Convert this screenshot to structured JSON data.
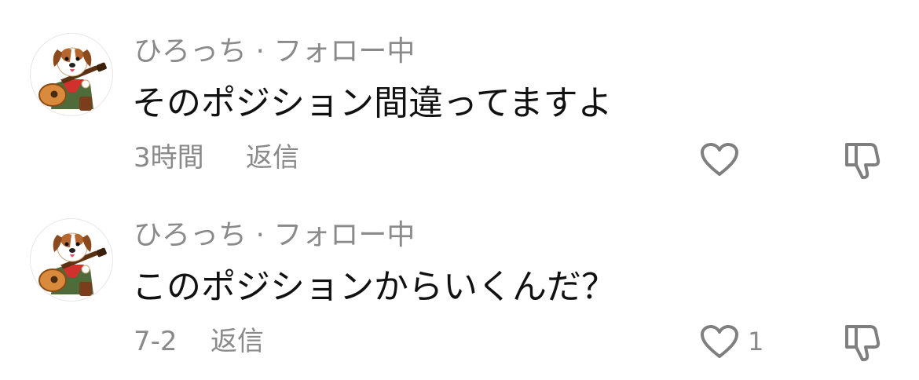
{
  "comments": [
    {
      "username": "ひろっち · フォロー中",
      "text": "そのポジション間違ってますよ",
      "timestamp": "3時間",
      "reply_label": "返信",
      "like_count": ""
    },
    {
      "username": "ひろっち · フォロー中",
      "text": "このポジションからいくんだ？",
      "timestamp": "7-2",
      "reply_label": "返信",
      "like_count": "1"
    }
  ],
  "icons": {
    "avatar": "dog-with-guitar-avatar",
    "like": "heart-outline-icon",
    "dislike": "thumbs-down-outline-icon"
  },
  "colors": {
    "text_primary": "#111111",
    "text_secondary": "#8a8a8a",
    "icon_stroke": "#7f7f7f",
    "background": "#ffffff"
  }
}
